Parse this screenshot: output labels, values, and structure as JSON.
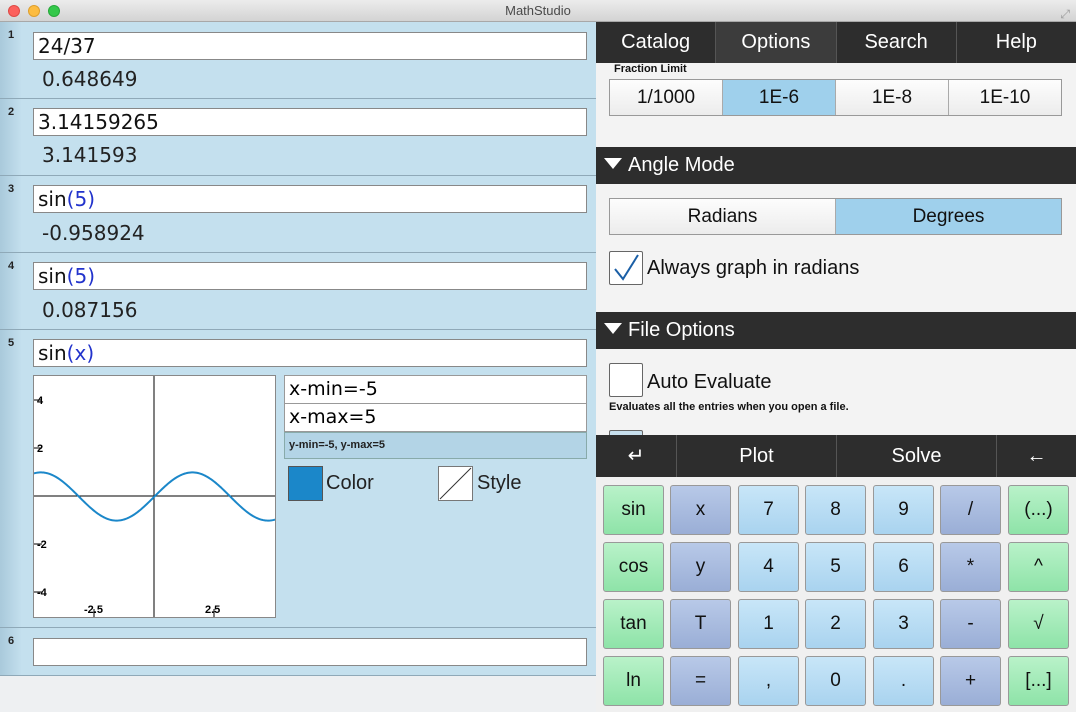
{
  "window": {
    "title": "MathStudio"
  },
  "entries": [
    {
      "num": "1",
      "input": "24/37",
      "result": "0.648649"
    },
    {
      "num": "2",
      "input": "3.14159265",
      "result": "3.141593"
    },
    {
      "num": "3",
      "fn": "sin",
      "arg": "5",
      "result": "-0.958924"
    },
    {
      "num": "4",
      "fn": "sin",
      "arg": "5",
      "result": "0.087156"
    },
    {
      "num": "5",
      "fn": "sin",
      "arg": "x"
    },
    {
      "num": "6",
      "input": ""
    }
  ],
  "plot": {
    "xmin_field": "x-min=-5",
    "xmax_field": "x-max=5",
    "yrange": "y-min=-5, y-max=5",
    "color_label": "Color",
    "style_label": "Style",
    "y_ticks": [
      "4",
      "2",
      "-2",
      "-4"
    ],
    "x_ticks": [
      "-2.5",
      "2.5"
    ],
    "curve_color": "#1b87c9"
  },
  "tabs": [
    "Catalog",
    "Options",
    "Search",
    "Help"
  ],
  "options": {
    "fraction_limit_label": "Fraction Limit",
    "fraction_limits": [
      "1/1000",
      "1E-6",
      "1E-8",
      "1E-10"
    ],
    "fraction_selected": "1E-6",
    "angle_mode_header": "Angle Mode",
    "angle_modes": [
      "Radians",
      "Degrees"
    ],
    "angle_selected": "Degrees",
    "graph_radians_label": "Always graph in radians",
    "graph_radians_checked": true,
    "file_options_header": "File Options",
    "auto_evaluate_label": "Auto Evaluate",
    "auto_evaluate_checked": false,
    "auto_evaluate_desc": "Evaluates all the entries when you open a file."
  },
  "keyboard_bar": {
    "enter": "↵",
    "plot": "Plot",
    "solve": "Solve",
    "back": "←"
  },
  "keys": [
    [
      "sin",
      "x",
      "7",
      "8",
      "9",
      "/",
      "(...)"
    ],
    [
      "cos",
      "y",
      "4",
      "5",
      "6",
      "*",
      "^"
    ],
    [
      "tan",
      "T",
      "1",
      "2",
      "3",
      "-",
      "√"
    ],
    [
      "ln",
      "=",
      ",",
      "0",
      ".",
      "+",
      "[...]"
    ]
  ]
}
